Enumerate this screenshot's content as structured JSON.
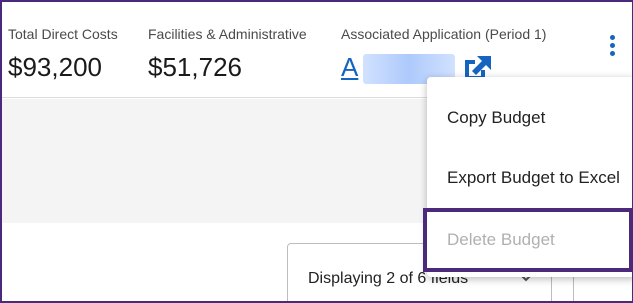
{
  "summary": {
    "total_direct_label": "Total Direct Costs",
    "total_direct_value": "$93,200",
    "fa_label": "Facilities & Administrative",
    "fa_value": "$51,726",
    "app_label": "Associated Application (Period 1)",
    "app_link_prefix": "A"
  },
  "menu": {
    "items": [
      {
        "label": "Copy Budget",
        "enabled": true
      },
      {
        "label": "Export Budget to Excel",
        "enabled": true
      },
      {
        "label": "Delete Budget",
        "enabled": false
      }
    ]
  },
  "fields_selector": {
    "text": "Displaying 2 of 6 fields"
  },
  "icons": {
    "external_link": "external-link-icon",
    "more": "kebab-menu-icon",
    "chevron": "chevron-down-icon"
  },
  "colors": {
    "accent": "#1565c0",
    "highlight_border": "#4b2a7b",
    "disabled_text": "#b0b0b0",
    "panel_bg": "#f4f4f5"
  }
}
